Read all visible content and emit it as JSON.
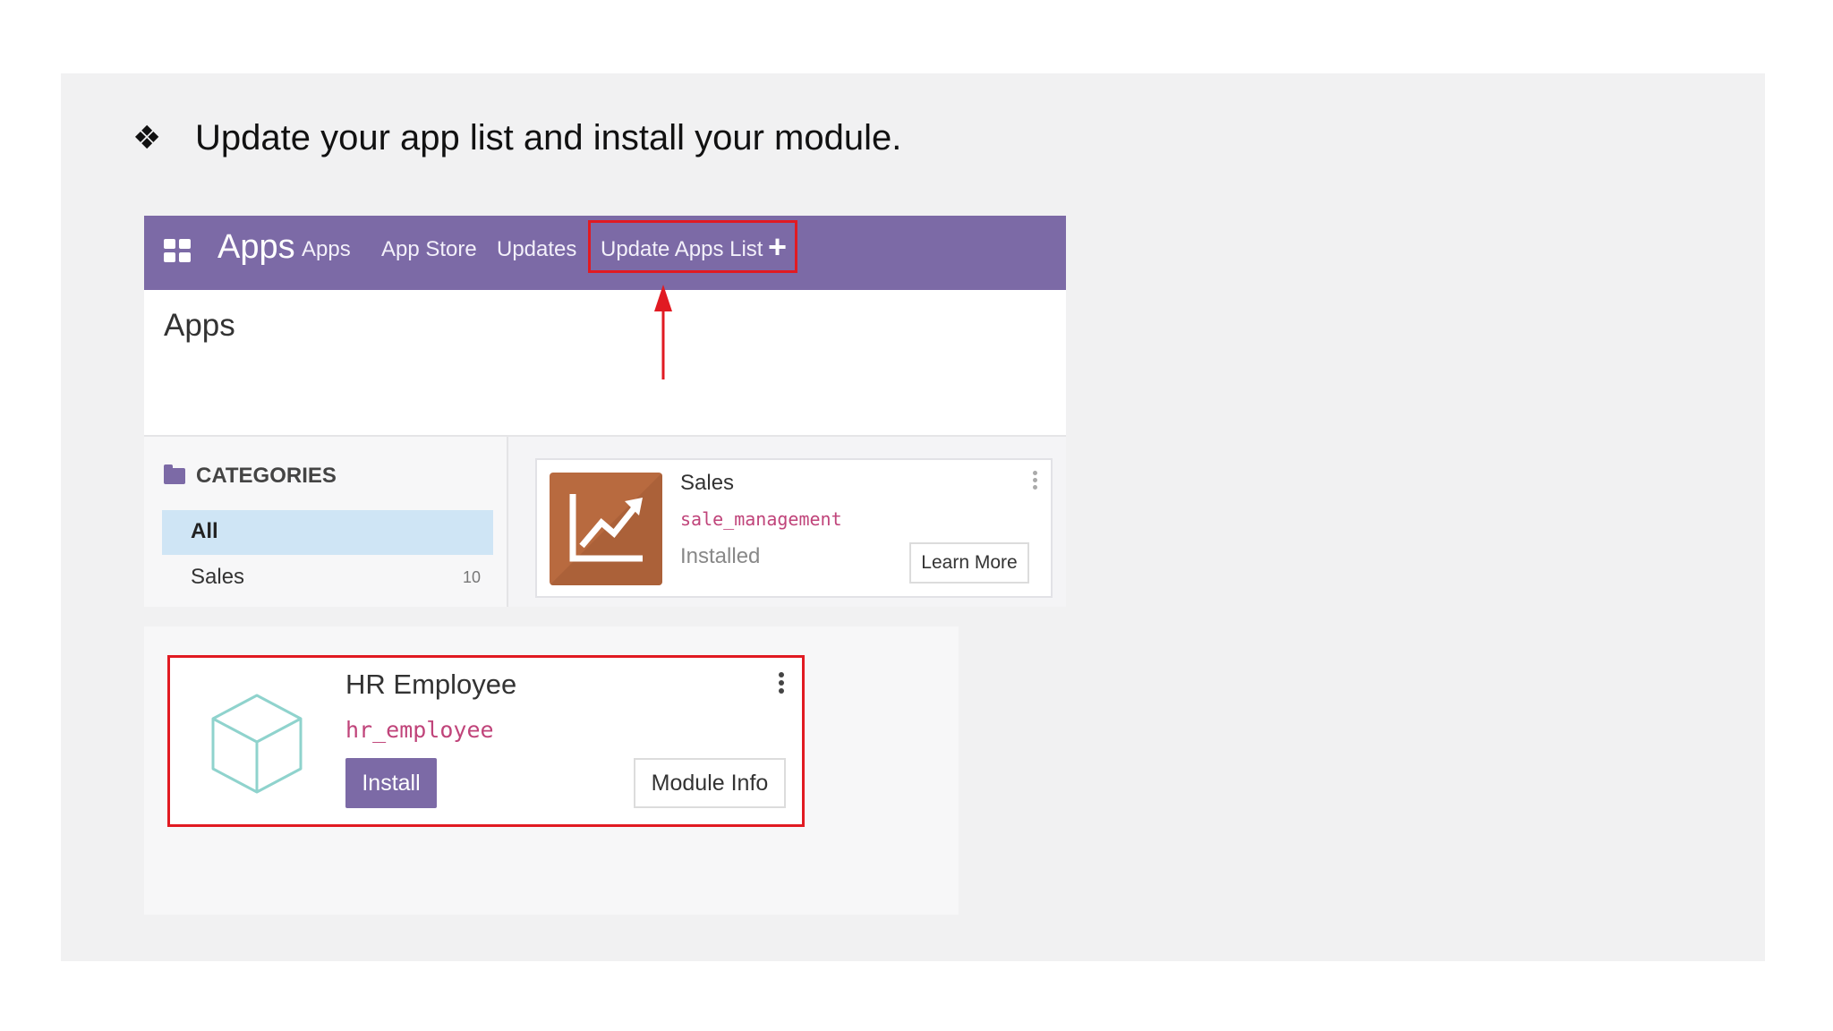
{
  "slide": {
    "bullet_glyph": "❖",
    "instruction": "Update your app list and install your module."
  },
  "navbar": {
    "brand": "Apps",
    "items": [
      "Apps",
      "App Store",
      "Updates",
      "Update Apps List"
    ],
    "add_symbol": "+",
    "background_color": "#7c6aa6",
    "highlight_color": "#e11a22"
  },
  "control_panel": {
    "title": "Apps"
  },
  "sidebar": {
    "heading": "CATEGORIES",
    "items": [
      {
        "label": "All",
        "selected": true
      },
      {
        "label": "Sales",
        "count": "10"
      }
    ]
  },
  "sales_card": {
    "icon": "chart-trend-up-icon",
    "name": "Sales",
    "technical_name": "sale_management",
    "status": "Installed",
    "button": "Learn More"
  },
  "hr_card": {
    "icon": "cube-icon",
    "name": "HR Employee",
    "technical_name": "hr_employee",
    "install_button": "Install",
    "info_button": "Module Info"
  }
}
